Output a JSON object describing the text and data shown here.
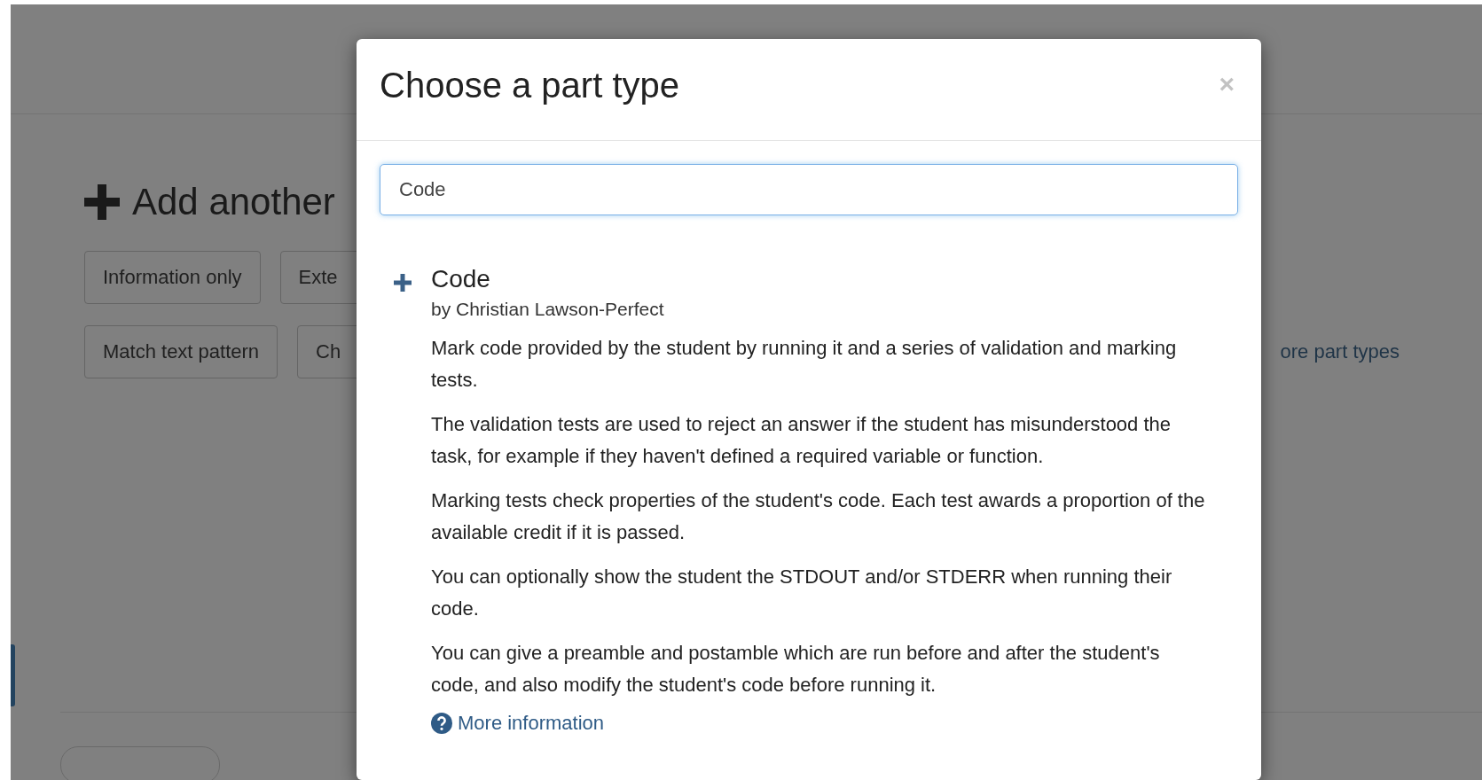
{
  "background": {
    "heading": "Add another",
    "button_rows": [
      [
        {
          "label": "Information only"
        },
        {
          "label": "Exte"
        }
      ],
      [
        {
          "label": "Match text pattern"
        },
        {
          "label": "Ch"
        }
      ]
    ],
    "more_link": "ore part types"
  },
  "modal": {
    "title": "Choose a part type",
    "close": "×",
    "search": {
      "value": "Code"
    },
    "results": [
      {
        "name": "Code",
        "author": "by Christian Lawson-Perfect",
        "paragraphs": [
          "Mark code provided by the student by running it and a series of validation and marking tests.",
          "The validation tests are used to reject an answer if the student has misunderstood the task, for example if they haven't defined a required variable or function.",
          "Marking tests check properties of the student's code. Each test awards a proportion of the available credit if it is passed.",
          "You can optionally show the student the STDOUT and/or STDERR when running their code.",
          "You can give a preamble and postamble which are run before and after the student's code, and also modify the student's code before running it."
        ],
        "more_link": "More information"
      }
    ]
  }
}
